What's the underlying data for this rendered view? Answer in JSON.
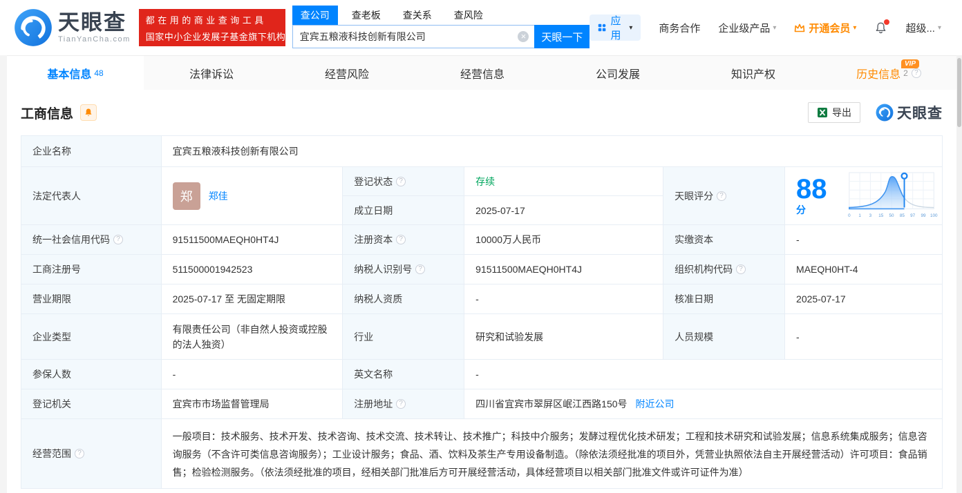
{
  "colors": {
    "accent": "#0084ff",
    "orange": "#ff8a00",
    "green": "#00a65e",
    "promo_red": "#e0251b"
  },
  "header": {
    "logo_title": "天眼查",
    "logo_subtitle": "TianYanCha.com",
    "promo_line1": "都在用的商业查询工具",
    "promo_line2": "国家中小企业发展子基金旗下机构",
    "search_tabs": [
      {
        "label": "查公司"
      },
      {
        "label": "查老板"
      },
      {
        "label": "查关系"
      },
      {
        "label": "查风险"
      }
    ],
    "search_value": "宜宾五粮液科技创新有限公司",
    "search_button": "天眼一下",
    "nav_apps": "应用",
    "nav_cooperation": "商务合作",
    "nav_enterprise": "企业级产品",
    "nav_vip": "开通会员",
    "nav_super": "超级..."
  },
  "tabs": {
    "basic": {
      "label": "基本信息",
      "count": "48"
    },
    "legal": {
      "label": "法律诉讼"
    },
    "risk": {
      "label": "经营风险"
    },
    "operation": {
      "label": "经营信息"
    },
    "development": {
      "label": "公司发展"
    },
    "ip": {
      "label": "知识产权"
    },
    "history": {
      "label": "历史信息",
      "count": "2",
      "vip": "VIP"
    }
  },
  "section": {
    "title": "工商信息",
    "export_label": "导出",
    "brand": "天眼查"
  },
  "table": {
    "company_name": {
      "label": "企业名称",
      "value": "宜宾五粮液科技创新有限公司"
    },
    "legal_rep": {
      "label": "法定代表人",
      "avatar": "郑",
      "value": "郑佳"
    },
    "reg_status": {
      "label": "登记状态",
      "value": "存续"
    },
    "est_date": {
      "label": "成立日期",
      "value": "2025-07-17"
    },
    "score": {
      "label": "天眼评分",
      "value": "88",
      "unit": "分",
      "axis": [
        "0",
        "1",
        "3",
        "15",
        "50",
        "85",
        "97",
        "99",
        "100"
      ],
      "marker": 88
    },
    "credit_code": {
      "label": "统一社会信用代码",
      "value": "91511500MAEQH0HT4J"
    },
    "reg_capital": {
      "label": "注册资本",
      "value": "10000万人民币"
    },
    "paid_capital": {
      "label": "实缴资本",
      "value": "-"
    },
    "reg_number": {
      "label": "工商注册号",
      "value": "511500001942523"
    },
    "taxpayer_id": {
      "label": "纳税人识别号",
      "value": "91511500MAEQH0HT4J"
    },
    "org_code": {
      "label": "组织机构代码",
      "value": "MAEQH0HT-4"
    },
    "business_term": {
      "label": "营业期限",
      "value": "2025-07-17 至 无固定期限"
    },
    "taxpayer_quality": {
      "label": "纳税人资质",
      "value": "-"
    },
    "approval_date": {
      "label": "核准日期",
      "value": "2025-07-17"
    },
    "company_type": {
      "label": "企业类型",
      "value": "有限责任公司（非自然人投资或控股的法人独资）"
    },
    "industry": {
      "label": "行业",
      "value": "研究和试验发展"
    },
    "staff_size": {
      "label": "人员规模",
      "value": "-"
    },
    "insured_count": {
      "label": "参保人数",
      "value": "-"
    },
    "english_name": {
      "label": "英文名称",
      "value": "-"
    },
    "reg_authority": {
      "label": "登记机关",
      "value": "宜宾市市场监督管理局"
    },
    "reg_address": {
      "label": "注册地址",
      "value": "四川省宜宾市翠屏区岷江西路150号",
      "link": "附近公司"
    },
    "business_scope": {
      "label": "经营范围",
      "value": "一般项目：技术服务、技术开发、技术咨询、技术交流、技术转让、技术推广；科技中介服务；发酵过程优化技术研发；工程和技术研究和试验发展；信息系统集成服务；信息咨询服务（不含许可类信息咨询服务）；工业设计服务；食品、酒、饮料及茶生产专用设备制造。（除依法须经批准的项目外，凭营业执照依法自主开展经营活动）许可项目：食品销售；检验检测服务。（依法须经批准的项目，经相关部门批准后方可开展经营活动，具体经营项目以相关部门批准文件或许可证件为准）"
    }
  }
}
